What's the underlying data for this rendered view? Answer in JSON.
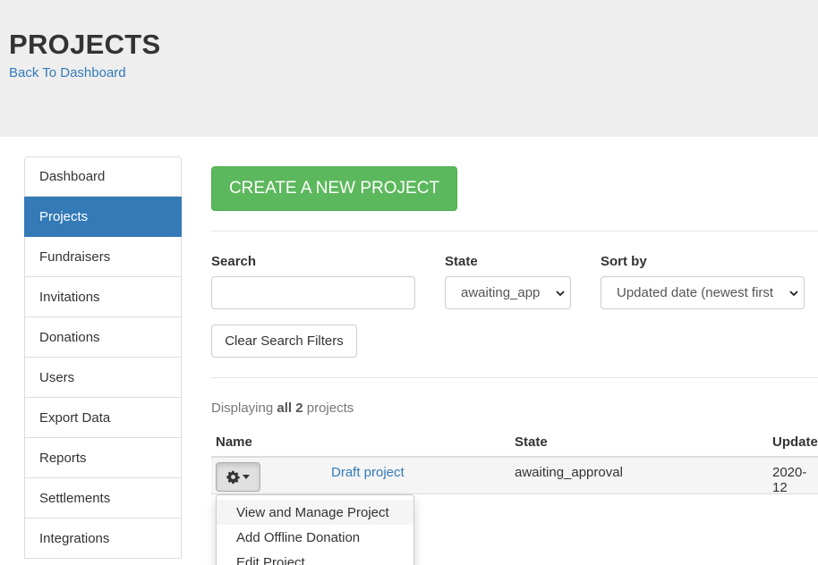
{
  "header": {
    "title": "PROJECTS",
    "back_link": "Back To Dashboard"
  },
  "sidebar": {
    "items": [
      {
        "label": "Dashboard",
        "active": false
      },
      {
        "label": "Projects",
        "active": true
      },
      {
        "label": "Fundraisers",
        "active": false
      },
      {
        "label": "Invitations",
        "active": false
      },
      {
        "label": "Donations",
        "active": false
      },
      {
        "label": "Users",
        "active": false
      },
      {
        "label": "Export Data",
        "active": false
      },
      {
        "label": "Reports",
        "active": false
      },
      {
        "label": "Settlements",
        "active": false
      },
      {
        "label": "Integrations",
        "active": false
      }
    ]
  },
  "actions": {
    "create_label": "CREATE A NEW PROJECT",
    "clear_label": "Clear Search Filters"
  },
  "filters": {
    "search_label": "Search",
    "search_value": "",
    "state_label": "State",
    "state_value": "awaiting_app",
    "sort_label": "Sort by",
    "sort_value": "Updated date (newest first"
  },
  "summary": {
    "prefix": "Displaying",
    "count_text": "all 2",
    "suffix": "projects"
  },
  "table": {
    "headers": {
      "name": "Name",
      "state": "State",
      "updated": "Update"
    },
    "rows": [
      {
        "name": "Draft project",
        "state": "awaiting_approval",
        "updated": "2020-12"
      }
    ]
  },
  "row_menu": {
    "icon": "gear-icon",
    "items": [
      "View and Manage Project",
      "Add Offline Donation",
      "Edit Project"
    ]
  },
  "colors": {
    "primary": "#337ab7",
    "success": "#5cb85c",
    "header_bg": "#eeeeee"
  }
}
